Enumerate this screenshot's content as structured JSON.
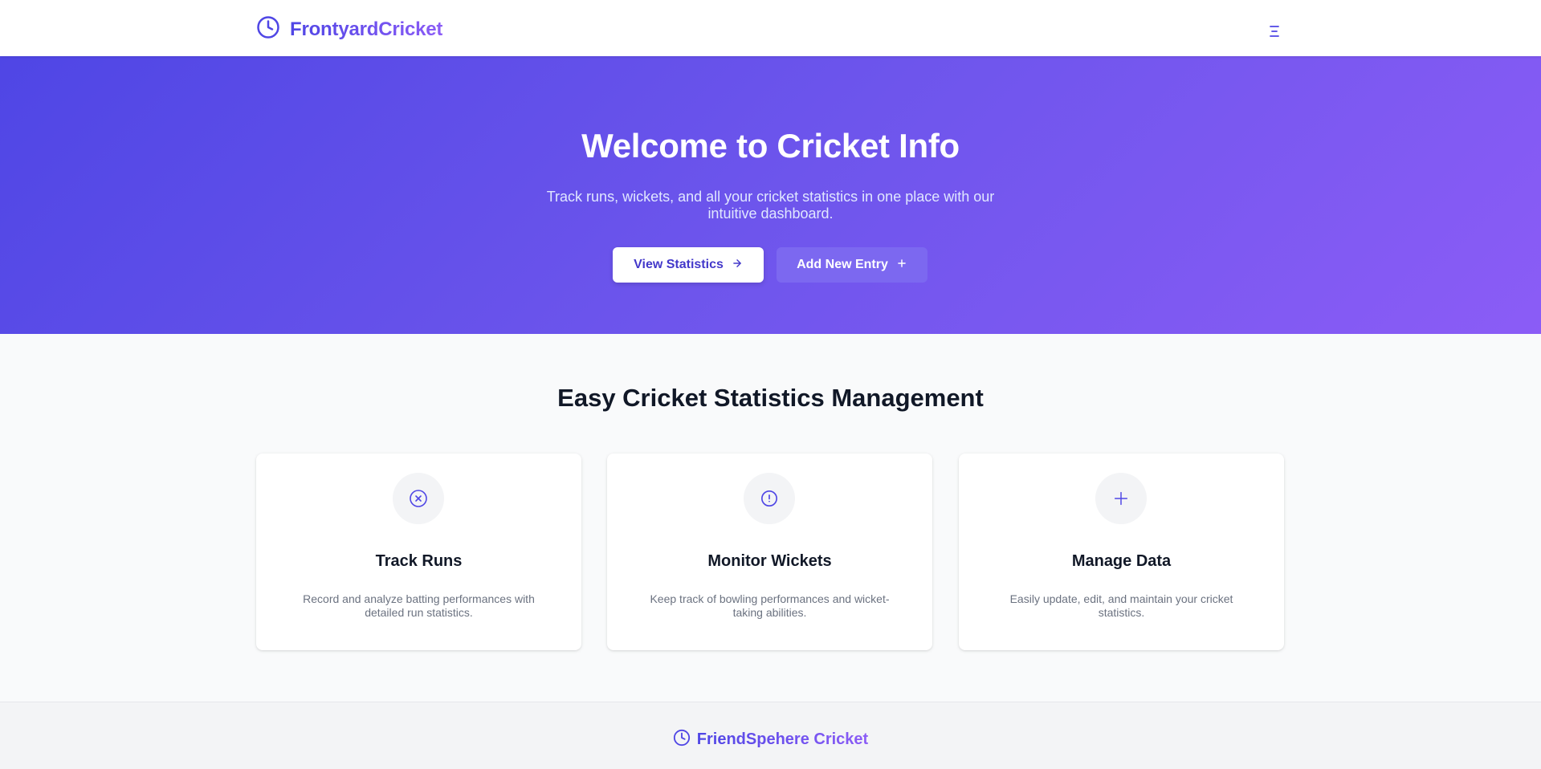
{
  "header": {
    "brand": "FrontyardCricket",
    "brand_icon": "clock-icon",
    "menu_icon": "hamburger-menu-icon"
  },
  "hero": {
    "title": "Welcome to Cricket Info",
    "subtitle": "Track runs, wickets, and all your cricket statistics in one place with our intuitive dashboard.",
    "primary_button": {
      "label": "View Statistics",
      "icon": "arrow-right-icon"
    },
    "secondary_button": {
      "label": "Add New Entry",
      "icon": "plus-icon"
    }
  },
  "features": {
    "title": "Easy Cricket Statistics Management",
    "cards": [
      {
        "title": "Track Runs",
        "text": "Record and analyze batting performances with detailed run statistics.",
        "icon": "circle-x-icon"
      },
      {
        "title": "Monitor Wickets",
        "text": "Keep track of bowling performances and wicket-taking abilities.",
        "icon": "alert-circle-icon"
      },
      {
        "title": "Manage Data",
        "text": "Easily update, edit, and maintain your cricket statistics.",
        "icon": "plus-icon"
      }
    ]
  },
  "footer": {
    "brand": "FriendSpehere Cricket",
    "brand_icon": "clock-icon"
  },
  "colors": {
    "accent": "#4f46e5",
    "accent_secondary": "#8b5cf6",
    "text_dark": "#111827",
    "text_muted": "#6b7280"
  }
}
